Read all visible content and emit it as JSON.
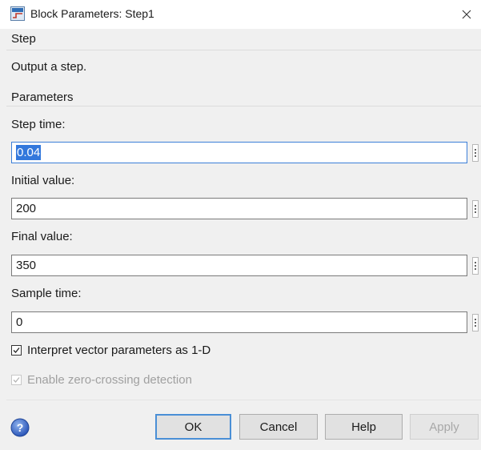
{
  "window": {
    "title": "Block Parameters: Step1",
    "close_glyph": "×",
    "app_icon": "simulink-block-icon"
  },
  "block": {
    "group_title": "Step",
    "description": "Output a step."
  },
  "parameters": {
    "group_title": "Parameters",
    "fields": [
      {
        "label": "Step time:",
        "value": "0.04",
        "focused": true,
        "selected": true
      },
      {
        "label": "Initial value:",
        "value": "200",
        "focused": false,
        "selected": false
      },
      {
        "label": "Final value:",
        "value": "350",
        "focused": false,
        "selected": false
      },
      {
        "label": "Sample time:",
        "value": "0",
        "focused": false,
        "selected": false
      }
    ],
    "checkboxes": [
      {
        "label": "Interpret vector parameters as 1-D",
        "checked": true,
        "enabled": true
      },
      {
        "label": "Enable zero-crossing detection",
        "checked": true,
        "enabled": false
      }
    ]
  },
  "footer": {
    "help_icon": "question-circle-icon",
    "buttons": {
      "ok": "OK",
      "cancel": "Cancel",
      "help": "Help",
      "apply": "Apply"
    }
  },
  "colors": {
    "selection": "#3378dc",
    "focus_border": "#3c7fd8",
    "window_bg": "#f0f0f0"
  }
}
